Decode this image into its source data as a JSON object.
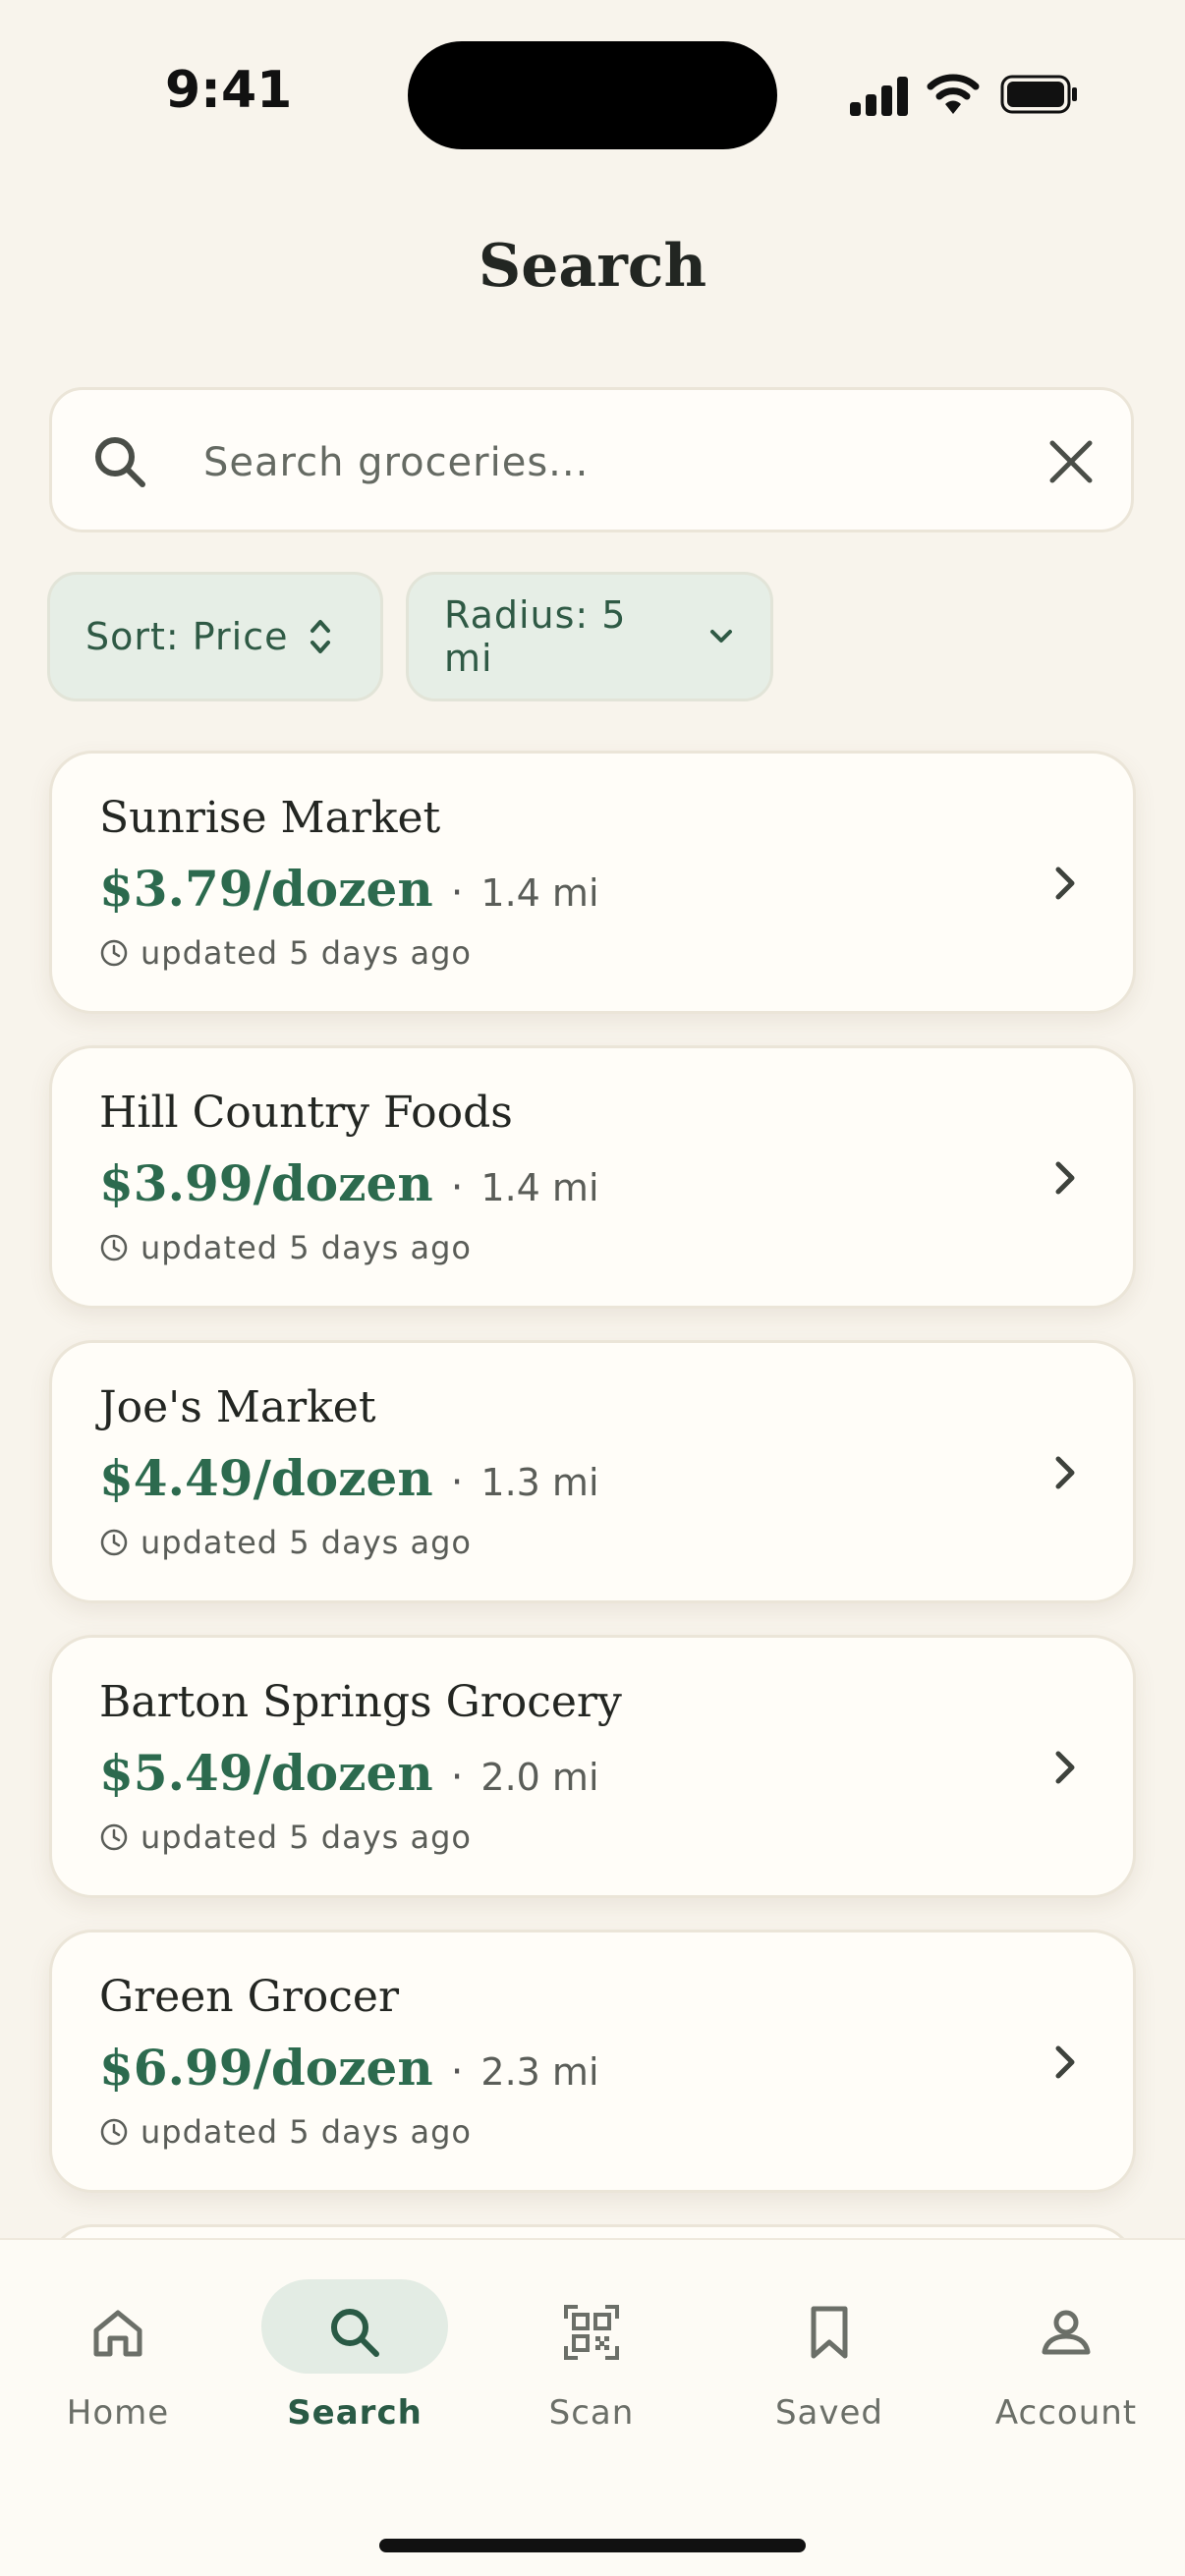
{
  "status_bar": {
    "time": "9:41"
  },
  "page": {
    "title": "Search"
  },
  "search": {
    "placeholder": "Search groceries...",
    "value": ""
  },
  "filters": {
    "sort_label": "Sort: Price",
    "radius_label": "Radius: 5 mi"
  },
  "results": [
    {
      "name": "Sunrise Market",
      "price": "$3.79/dozen",
      "distance": "1.4 mi",
      "updated": "updated 5 days ago"
    },
    {
      "name": "Hill Country Foods",
      "price": "$3.99/dozen",
      "distance": "1.4 mi",
      "updated": "updated 5 days ago"
    },
    {
      "name": "Joe's Market",
      "price": "$4.49/dozen",
      "distance": "1.3 mi",
      "updated": "updated 5 days ago"
    },
    {
      "name": "Barton Springs Grocery",
      "price": "$5.49/dozen",
      "distance": "2.0 mi",
      "updated": "updated 5 days ago"
    },
    {
      "name": "Green Grocer",
      "price": "$6.99/dozen",
      "distance": "2.3 mi",
      "updated": "updated 5 days ago"
    }
  ],
  "separator": "·",
  "tabs": [
    {
      "label": "Home",
      "icon": "home-icon",
      "active": false
    },
    {
      "label": "Search",
      "icon": "search-icon",
      "active": true
    },
    {
      "label": "Scan",
      "icon": "qr-scan-icon",
      "active": false
    },
    {
      "label": "Saved",
      "icon": "bookmark-icon",
      "active": false
    },
    {
      "label": "Account",
      "icon": "person-icon",
      "active": false
    }
  ],
  "colors": {
    "background": "#f8f4ec",
    "accent": "#2c6a4e",
    "chip_background": "#e6eee6",
    "card_background": "#fffdf8"
  }
}
